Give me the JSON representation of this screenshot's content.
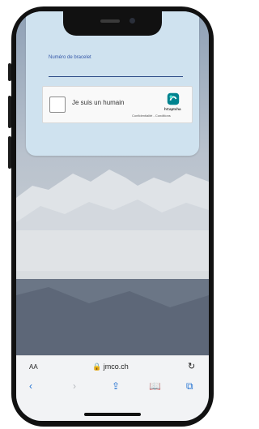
{
  "form": {
    "field_label": "Numéro de bracelet"
  },
  "captcha": {
    "checkbox_text": "Je suis un humain",
    "brand": "hCaptcha",
    "links": "Confidentialité - Conditions"
  },
  "browser": {
    "aa": "AA",
    "url": "jmco.ch",
    "reload_icon": "↻",
    "back_icon": "‹",
    "forward_icon": "›",
    "share_icon": "⇪",
    "bookmarks_icon": "📖",
    "tabs_icon": "⧉"
  }
}
